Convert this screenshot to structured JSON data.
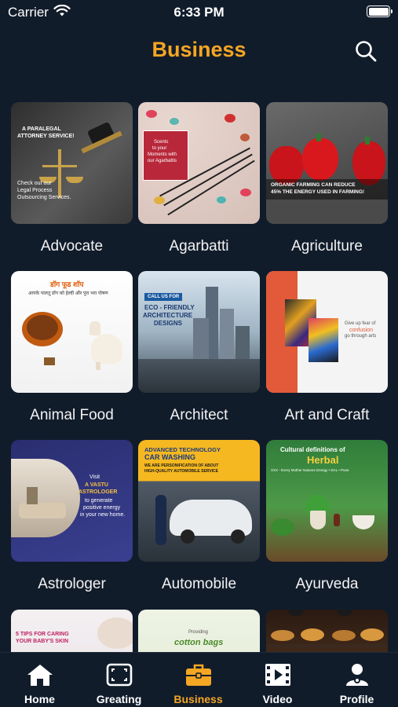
{
  "status": {
    "carrier": "Carrier",
    "time": "6:33 PM",
    "battery_level": 1.0
  },
  "header": {
    "title": "Business"
  },
  "categories": [
    {
      "label": "Advocate",
      "overlay": [
        "A PARALEGAL",
        "ATTORNEY SERVICE!",
        "Check out our",
        "Legal Process",
        "Outsourcing Services."
      ]
    },
    {
      "label": "Agarbatti",
      "overlay": [
        "Scents",
        "to your",
        "Moments with",
        "our Agarbattis"
      ]
    },
    {
      "label": "Agriculture",
      "overlay": [
        "ORGANIC FARMING CAN REDUCE",
        "45% THE ENERGY USED IN FARMING!"
      ]
    },
    {
      "label": "Animal Food",
      "overlay": [
        "डॉग फूड शॉप",
        "आपके पालतू डॉग को हेल्दी और पूरा भरा पोषण"
      ]
    },
    {
      "label": "Architect",
      "overlay": [
        "CALL US FOR",
        "ECO - FRIENDLY",
        "ARCHITECTURE",
        "DESIGNS"
      ]
    },
    {
      "label": "Art and Craft",
      "overlay": [
        "Give up fear of",
        "confusion",
        "go through arts"
      ]
    },
    {
      "label": "Astrologer",
      "overlay": [
        "Visit",
        "A VASTU",
        "ASTROLOGER",
        "to generate",
        "positive energy",
        "in your new home."
      ]
    },
    {
      "label": "Automobile",
      "overlay": [
        "ADVANCED TECHNOLOGY",
        "CAR WASHING",
        "WE ARE PERSONIFICATION OF ABOUT",
        "HIGH-QUALITY AUTOMOBILE SERVICE"
      ]
    },
    {
      "label": "Ayurveda",
      "overlay": [
        "Cultural definitions of",
        "Herbal",
        "XXX - Every Mother Natures Energy • DAL • Pune"
      ]
    },
    {
      "label": "",
      "overlay": [
        "5 TIPS FOR CARING",
        "YOUR BABY'S SKIN"
      ]
    },
    {
      "label": "",
      "overlay": [
        "Providing",
        "cotton bags"
      ]
    },
    {
      "label": "",
      "overlay": []
    }
  ],
  "tabs": [
    {
      "label": "Home",
      "icon": "home-icon"
    },
    {
      "label": "Greating",
      "icon": "greeting-frame-icon"
    },
    {
      "label": "Business",
      "icon": "briefcase-icon",
      "active": true
    },
    {
      "label": "Video",
      "icon": "video-icon"
    },
    {
      "label": "Profile",
      "icon": "profile-icon"
    }
  ],
  "colors": {
    "background": "#111c2b",
    "accent": "#f5a623",
    "text": "#ffffff"
  }
}
